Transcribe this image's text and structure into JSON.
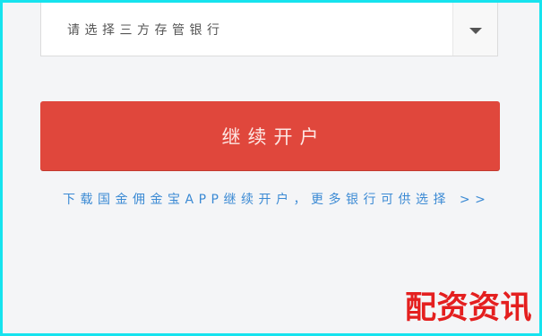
{
  "bank_select": {
    "placeholder": "请选择三方存管银行",
    "arrow_icon": "chevron-down-icon"
  },
  "continue_button": {
    "label": "继续开户"
  },
  "download_link": {
    "text": "下载国金佣金宝APP继续开户，更多银行可供选择 >>"
  },
  "watermark": {
    "text": "配资资讯"
  },
  "colors": {
    "frame": "#16e3ee",
    "background": "#f4f5f7",
    "button": "#e0473c",
    "link": "#3b8ad4",
    "watermark": "#e41f1f"
  }
}
